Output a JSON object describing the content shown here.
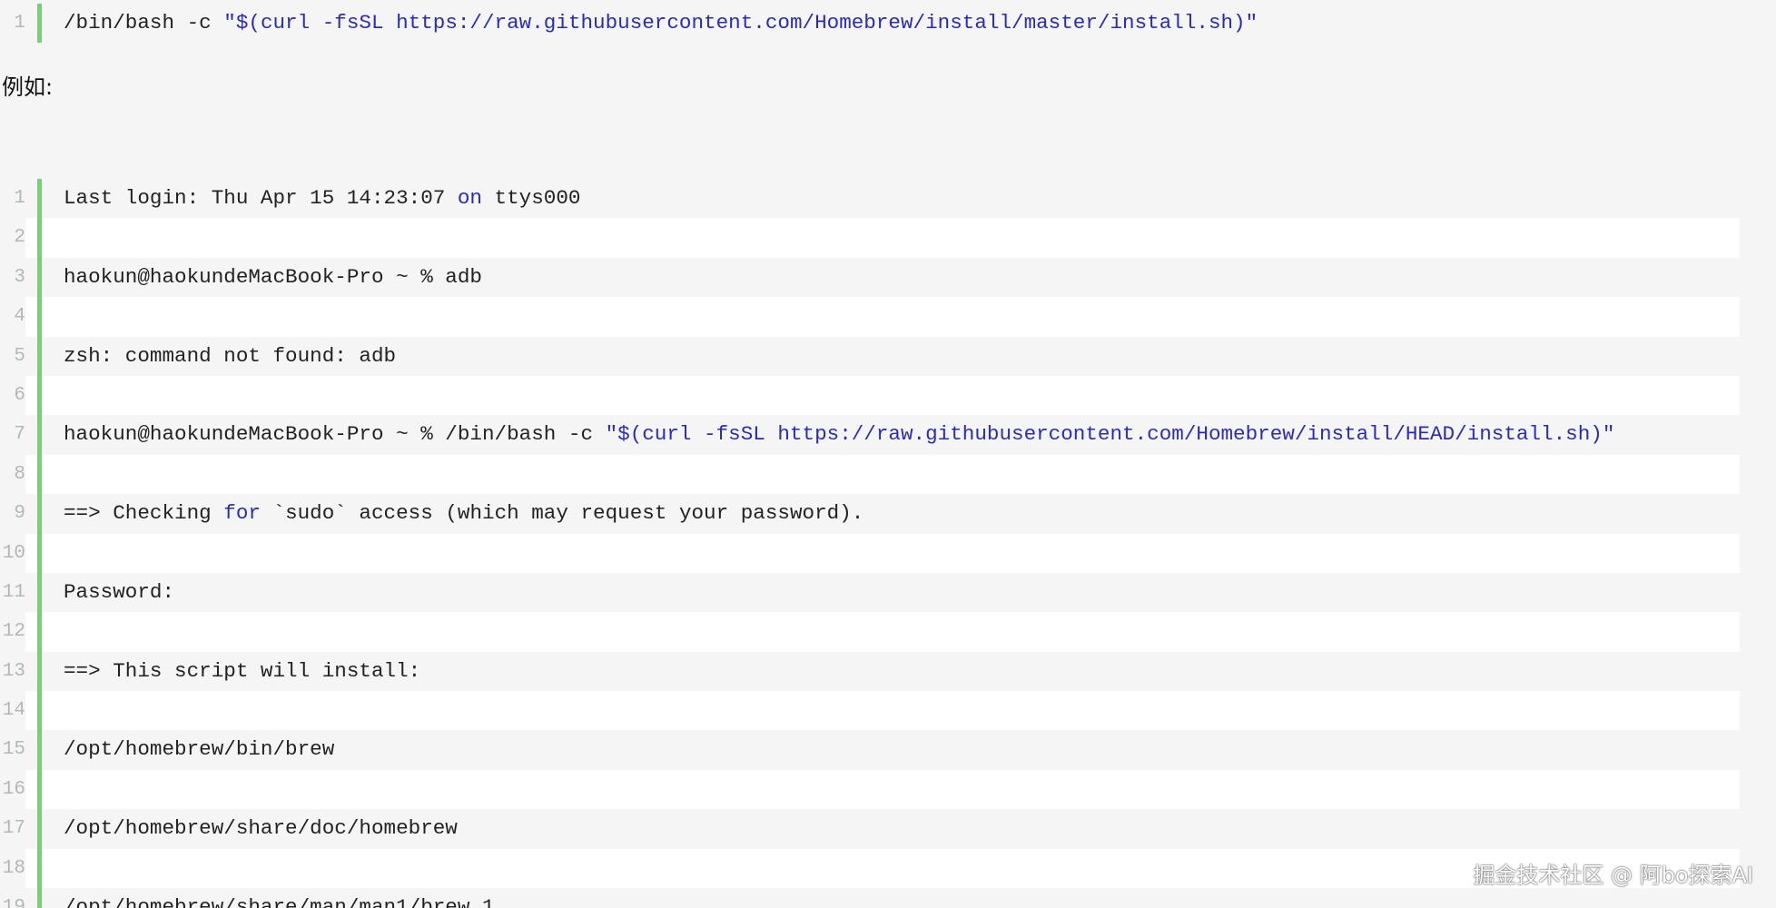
{
  "code_block_1": {
    "lines": [
      {
        "n": "1",
        "segments": [
          {
            "t": "/bin/bash -c ",
            "c": "plain"
          },
          {
            "t": "\"$(curl -fsSL https://raw.githubusercontent.com/Homebrew/install/master/install.sh)\"",
            "c": "str"
          }
        ]
      }
    ]
  },
  "prose": {
    "example_label": "例如:"
  },
  "code_block_2": {
    "lines": [
      {
        "n": "1",
        "segments": [
          {
            "t": "Last login: Thu Apr 15 14:23:07 ",
            "c": "plain"
          },
          {
            "t": "on",
            "c": "kw"
          },
          {
            "t": " ttys000",
            "c": "plain"
          }
        ]
      },
      {
        "n": "2",
        "segments": []
      },
      {
        "n": "3",
        "segments": [
          {
            "t": "haokun@haokundeMacBook-Pro ~ % adb",
            "c": "plain"
          }
        ]
      },
      {
        "n": "4",
        "segments": []
      },
      {
        "n": "5",
        "segments": [
          {
            "t": "zsh: command not found: adb",
            "c": "plain"
          }
        ]
      },
      {
        "n": "6",
        "segments": []
      },
      {
        "n": "7",
        "segments": [
          {
            "t": "haokun@haokundeMacBook-Pro ~ % /bin/bash -c ",
            "c": "plain"
          },
          {
            "t": "\"$(curl -fsSL https://raw.githubusercontent.com/Homebrew/install/HEAD/install.sh)\"",
            "c": "str"
          }
        ]
      },
      {
        "n": "8",
        "segments": []
      },
      {
        "n": "9",
        "segments": [
          {
            "t": "==> Checking ",
            "c": "plain"
          },
          {
            "t": "for",
            "c": "kw"
          },
          {
            "t": " `sudo` access (which may request your password).",
            "c": "plain"
          }
        ]
      },
      {
        "n": "10",
        "segments": []
      },
      {
        "n": "11",
        "segments": [
          {
            "t": "Password:",
            "c": "plain"
          }
        ]
      },
      {
        "n": "12",
        "segments": []
      },
      {
        "n": "13",
        "segments": [
          {
            "t": "==> This script will install:",
            "c": "plain"
          }
        ]
      },
      {
        "n": "14",
        "segments": []
      },
      {
        "n": "15",
        "segments": [
          {
            "t": "/opt/homebrew/bin/brew",
            "c": "plain"
          }
        ]
      },
      {
        "n": "16",
        "segments": []
      },
      {
        "n": "17",
        "segments": [
          {
            "t": "/opt/homebrew/share/doc/homebrew",
            "c": "plain"
          }
        ]
      },
      {
        "n": "18",
        "segments": []
      },
      {
        "n": "19",
        "segments": [
          {
            "t": "/opt/homebrew/share/man/man1/brew.1",
            "c": "plain"
          }
        ]
      }
    ]
  },
  "watermark": {
    "text": "掘金技术社区 @ 阿bo探索AI"
  },
  "colors": {
    "page_background": "#f5f5f5",
    "alt_row_background": "#ffffff",
    "gutter_bar": "#6fd66f",
    "keyword_string": "#2a2ac0",
    "line_number": "#b6b6b6"
  }
}
